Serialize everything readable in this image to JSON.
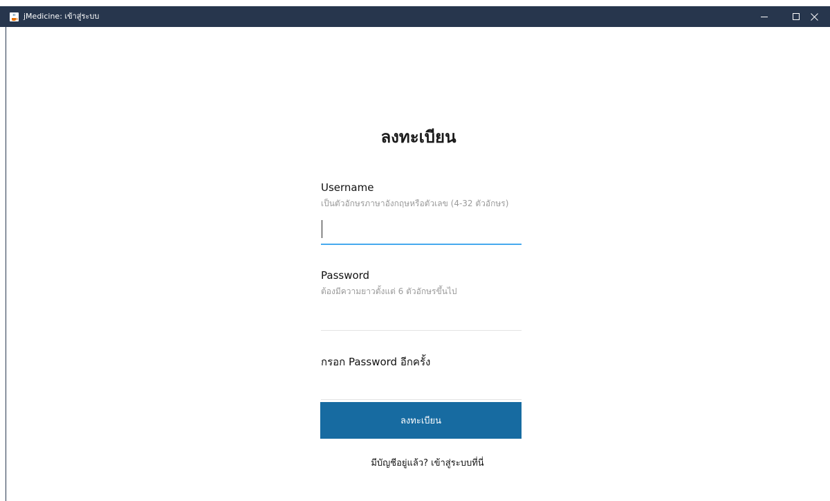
{
  "window": {
    "title": "jMedicine: เข้าสู่ระบบ",
    "app_icon": "java-coffee-icon",
    "controls": {
      "minimize_icon": "minimize-icon",
      "maximize_icon": "maximize-icon",
      "close_icon": "close-icon"
    },
    "titlebar_color": "#27364d"
  },
  "form": {
    "heading": "ลงทะเบียน",
    "username": {
      "label": "Username",
      "hint": "เป็นตัวอักษรภาษาอังกฤษหรือตัวเลข (4-32 ตัวอักษร)",
      "value": "",
      "focused": true
    },
    "password": {
      "label": "Password",
      "hint": "ต้องมีความยาวตั้งแต่ 6 ตัวอักษรขึ้นไป",
      "value": ""
    },
    "confirm_password": {
      "label": "กรอก Password อีกครั้ง",
      "value": ""
    },
    "submit_label": "ลงทะเบียน",
    "submit_color": "#176ba1",
    "focus_color": "#45a9ee",
    "login_link": "มีบัญชีอยู่แล้ว? เข้าสู่ระบบที่นี่"
  }
}
